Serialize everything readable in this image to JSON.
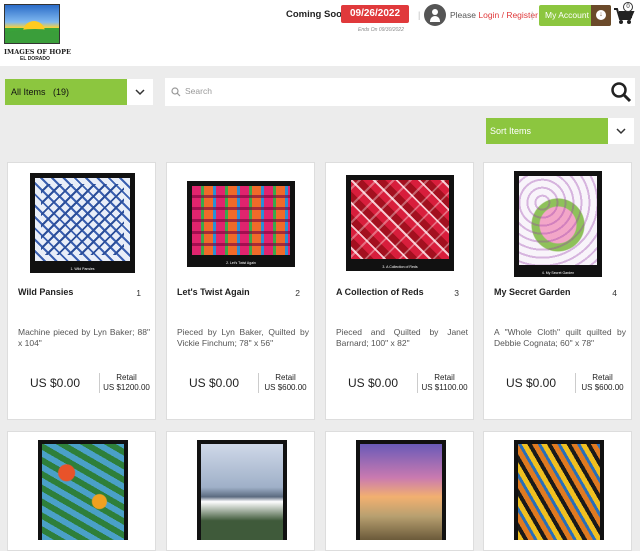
{
  "header": {
    "logo_line1": "IMAGES OF HOPE",
    "logo_line2": "EL DORADO",
    "coming_soon": "Coming Soon",
    "date": "09/26/2022",
    "ends": "Ends On 09/30/2022",
    "please": "Please",
    "login": "Login",
    "slash": "/",
    "register": "Register",
    "my_account": "My Account",
    "cart_count": "0",
    "sep": "|"
  },
  "toolbar": {
    "filter_label": "All Items",
    "filter_count": "(19)",
    "search_placeholder": "Search",
    "sort_label": "Sort Items"
  },
  "items": [
    {
      "title": "Wild Pansies",
      "num": "1",
      "desc": "Machine pieced by Lyn Baker; 88\" x 104\"",
      "price": "US $0.00",
      "retail_label": "Retail",
      "retail": "US $1200.00",
      "caption": "1. Wild Pansies"
    },
    {
      "title": "Let's Twist Again",
      "num": "2",
      "desc": "Pieced by Lyn Baker, Quilted by Vickie Finchum; 78\" x 56\"",
      "price": "US $0.00",
      "retail_label": "Retail",
      "retail": "US $600.00",
      "caption": "2. Let's Twist Again"
    },
    {
      "title": "A Collection of Reds",
      "num": "3",
      "desc": "Pieced and Quilted by Janet Barnard; 100\" x 82\"",
      "price": "US $0.00",
      "retail_label": "Retail",
      "retail": "US $1100.00",
      "caption": "3. A Collection of Reds"
    },
    {
      "title": "My Secret Garden",
      "num": "4",
      "desc": "A \"Whole Cloth\" quilt quilted by Debbie Cognata; 60\" x 78\"",
      "price": "US $0.00",
      "retail_label": "Retail",
      "retail": "US $600.00",
      "caption": "4. My Secret Garden"
    }
  ],
  "colors": {
    "accent": "#8cc63f",
    "date_badge": "#e0393b",
    "link": "#e0393b",
    "account_icon": "#6b4a2a"
  }
}
